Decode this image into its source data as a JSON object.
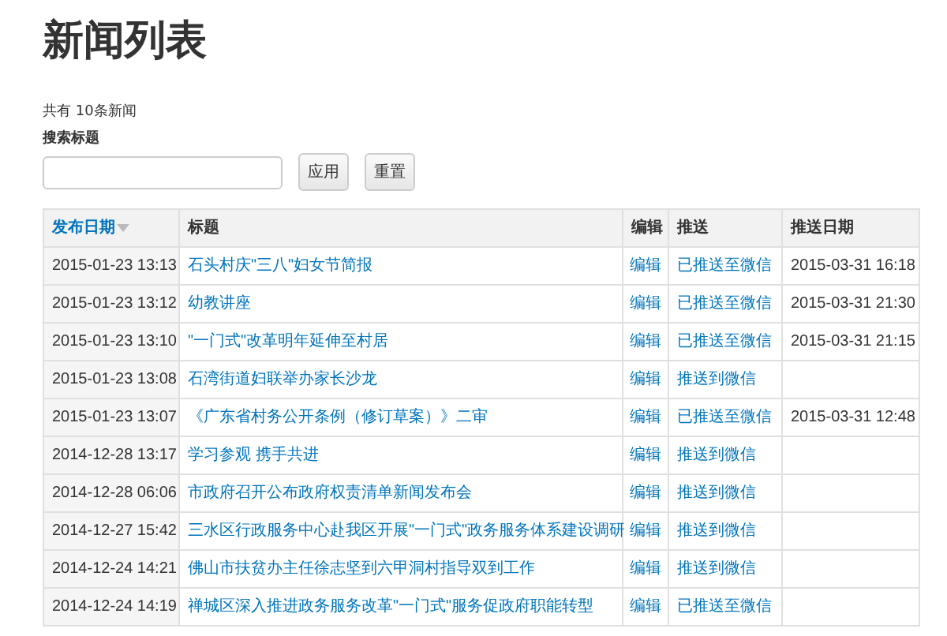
{
  "page_title": "新闻列表",
  "summary": "共有 10条新闻",
  "search": {
    "label": "搜索标题",
    "buttons": [
      "应用",
      "重置"
    ]
  },
  "table": {
    "columns": [
      {
        "label": "发布日期",
        "sortable": true,
        "sorted": true
      },
      {
        "label": "标题",
        "sortable": false,
        "sorted": false
      },
      {
        "label": "编辑",
        "sortable": false,
        "sorted": false
      },
      {
        "label": "推送",
        "sortable": false,
        "sorted": false
      },
      {
        "label": "推送日期",
        "sortable": false,
        "sorted": false
      }
    ],
    "rows": [
      {
        "date": "2015-01-23 13:13",
        "title": "石头村庆\"三八\"妇女节简报",
        "edit": "编辑",
        "push": "已推送至微信",
        "push_date": "2015-03-31 16:18"
      },
      {
        "date": "2015-01-23 13:12",
        "title": "幼教讲座",
        "edit": "编辑",
        "push": "已推送至微信",
        "push_date": "2015-03-31 21:30"
      },
      {
        "date": "2015-01-23 13:10",
        "title": "\"一门式\"改革明年延伸至村居",
        "edit": "编辑",
        "push": "已推送至微信",
        "push_date": "2015-03-31 21:15"
      },
      {
        "date": "2015-01-23 13:08",
        "title": "石湾街道妇联举办家长沙龙",
        "edit": "编辑",
        "push": "推送到微信"
      },
      {
        "date": "2015-01-23 13:07",
        "title": "《广东省村务公开条例（修订草案）》二审",
        "edit": "编辑",
        "push": "已推送至微信",
        "push_date": "2015-03-31 12:48"
      },
      {
        "date": "2014-12-28 13:17",
        "title": "学习参观 携手共进",
        "edit": "编辑",
        "push": "推送到微信"
      },
      {
        "date": "2014-12-28 06:06",
        "title": "市政府召开公布政府权责清单新闻发布会",
        "edit": "编辑",
        "push": "推送到微信"
      },
      {
        "date": "2014-12-27 15:42",
        "title": "三水区行政服务中心赴我区开展\"一门式\"政务服务体系建设调研",
        "edit": "编辑",
        "push": "推送到微信"
      },
      {
        "date": "2014-12-24 14:21",
        "title": "佛山市扶贫办主任徐志坚到六甲洞村指导双到工作",
        "edit": "编辑",
        "push": "推送到微信"
      },
      {
        "date": "2014-12-24 14:19",
        "title": "禅城区深入推进政务服务改革\"一门式\"服务促政府职能转型",
        "edit": "编辑",
        "push": "已推送至微信"
      }
    ]
  }
}
